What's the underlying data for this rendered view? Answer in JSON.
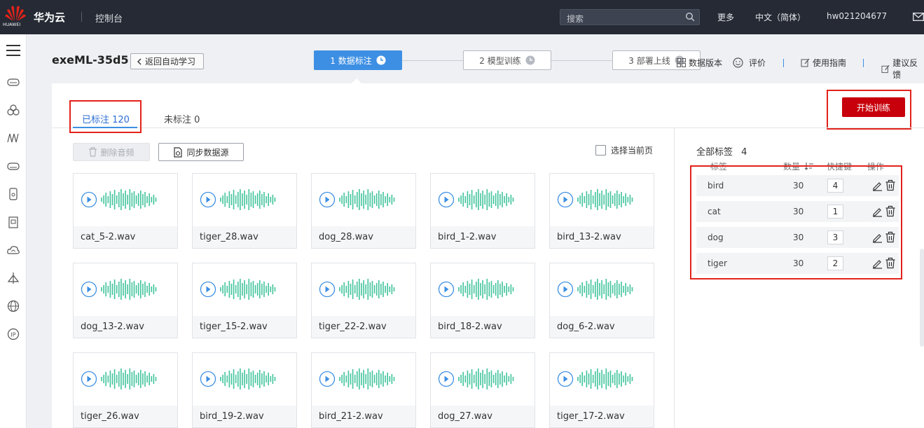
{
  "colors": {
    "topbar": "#252a34",
    "accent": "#3d8fe3",
    "primary_button": "#c7000b",
    "wave": "#41c39b",
    "highlight_box": "#e2221b"
  },
  "topbar": {
    "logo_text": "HUAWEI",
    "brand": "华为云",
    "console": "控制台",
    "search_placeholder": "搜索",
    "more": "更多",
    "language": "中文（简体）",
    "user": "hw021204677"
  },
  "sidebar_icons": [
    "menu-icon",
    "cloud-server-icon",
    "cloud-group-icon",
    "network-icon",
    "storage-icon",
    "database-icon",
    "document-icon",
    "cloud-monitor-icon",
    "ai-icon",
    "globe-icon",
    "ip-icon"
  ],
  "header": {
    "project": "exeML-35d5",
    "back": "返回自动学习",
    "steps": [
      "1 数据标注",
      "2 模型训练",
      "3 部署上线"
    ],
    "tools": {
      "version": "数据版本",
      "rate": "评价",
      "guide": "使用指南",
      "feedback": "建议反馈"
    }
  },
  "tabs": {
    "labeled": "已标注 120",
    "unlabeled": "未标注 0"
  },
  "actions": {
    "delete": "删除音频",
    "sync": "同步数据源",
    "select_page": "选择当前页",
    "train": "开始训练"
  },
  "files": [
    "cat_5-2.wav",
    "tiger_28.wav",
    "dog_28.wav",
    "bird_1-2.wav",
    "bird_13-2.wav",
    "dog_13-2.wav",
    "tiger_15-2.wav",
    "tiger_22-2.wav",
    "bird_18-2.wav",
    "dog_6-2.wav",
    "tiger_26.wav",
    "bird_19-2.wav",
    "bird_21-2.wav",
    "dog_27.wav",
    "tiger_17-2.wav"
  ],
  "labels_panel": {
    "title": "全部标签",
    "total": "4",
    "columns": {
      "label": "标签",
      "count": "数量",
      "hotkey": "快捷键",
      "ops": "操作"
    },
    "rows": [
      {
        "name": "bird",
        "count": "30",
        "key": "4"
      },
      {
        "name": "cat",
        "count": "30",
        "key": "1"
      },
      {
        "name": "dog",
        "count": "30",
        "key": "3"
      },
      {
        "name": "tiger",
        "count": "30",
        "key": "2"
      }
    ]
  }
}
